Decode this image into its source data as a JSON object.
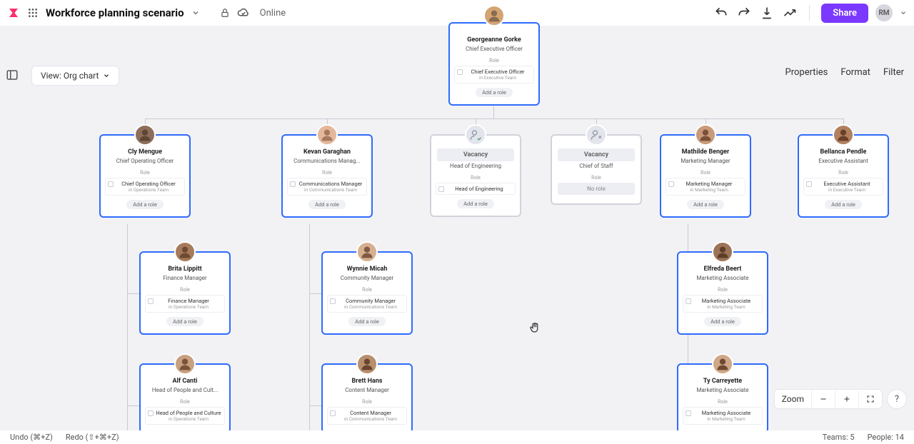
{
  "header": {
    "title": "Workforce planning scenario",
    "status": "Online",
    "share_label": "Share",
    "avatar_initials": "RM"
  },
  "subbar": {
    "view_label": "View: Org chart",
    "properties": "Properties",
    "format": "Format",
    "filter": "Filter"
  },
  "footer": {
    "undo": "Undo (⌘+Z)",
    "redo": "Redo (⇧+⌘+Z)",
    "teams_label": "Teams:",
    "teams_count": "5",
    "people_label": "People:",
    "people_count": "14",
    "zoom_label": "Zoom"
  },
  "common": {
    "role_heading": "Role",
    "add_role": "Add a role",
    "no_role": "No role",
    "vacancy": "Vacancy"
  },
  "cards": {
    "root": {
      "name": "Georgeanne Gorke",
      "title": "Chief Executive Officer",
      "role": "Chief Executive Officer",
      "team": "in Executive Team"
    },
    "cly": {
      "name": "Cly Mengue",
      "title": "Chief Operating Officer",
      "role": "Chief Operating Officer",
      "team": "in Operations Team"
    },
    "kevan": {
      "name": "Kevan Garaghan",
      "title": "Communications Manag...",
      "role": "Communications Manager",
      "team": "in Communications Team"
    },
    "vac1": {
      "title": "Head of Engineering",
      "role": "Head of Engineering"
    },
    "vac2": {
      "title": "Chief of Staff"
    },
    "mathilde": {
      "name": "Mathilde Benger",
      "title": "Marketing Manager",
      "role": "Marketing Manager",
      "team": "in Marketing Team"
    },
    "bellanca": {
      "name": "Bellanca Pendle",
      "title": "Executive Assistant",
      "role": "Executive Assistant",
      "team": "in Executive Team"
    },
    "brita": {
      "name": "Brita Lippitt",
      "title": "Finance Manager",
      "role": "Finance Manager",
      "team": "in Operations Team"
    },
    "wynnie": {
      "name": "Wynnie Micah",
      "title": "Community Manager",
      "role": "Community Manager",
      "team": "in Communications Team"
    },
    "elfreda": {
      "name": "Elfreda Beert",
      "title": "Marketing Associate",
      "role": "Marketing Associate",
      "team": "in Marketing Team"
    },
    "alf": {
      "name": "Alf Canti",
      "title": "Head of People and Cult...",
      "role": "Head of People and Culture",
      "team": "in Operations Team"
    },
    "brett": {
      "name": "Brett Hans",
      "title": "Content Manager",
      "role": "Content Manager",
      "team": "in Communications Team"
    },
    "ty": {
      "name": "Ty Carreyette",
      "title": "Marketing Associate",
      "role": "Marketing Associate",
      "team": "in Marketing Team"
    }
  }
}
